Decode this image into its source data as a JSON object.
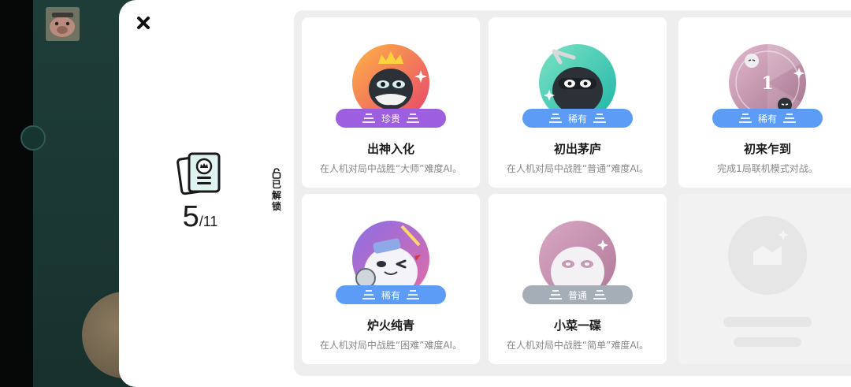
{
  "progress": {
    "unlocked": "5",
    "total": "/11"
  },
  "unlock_label": [
    "已",
    "解",
    "锁"
  ],
  "colors": {
    "precious": "#9d5fe0",
    "rare": "#5c9bf6",
    "common": "#a5adb7"
  },
  "achievements": [
    {
      "title": "出神入化",
      "desc": "在人机对局中战胜“大师”难度AI。",
      "rarity": "珍贵",
      "icon": "king-bomb-icon"
    },
    {
      "title": "初出茅庐",
      "desc": "在人机对局中战胜“普通”难度AI。",
      "rarity": "稀有",
      "icon": "ninja-bomb-icon"
    },
    {
      "title": "初来乍到",
      "desc": "完成1局联机模式对战。",
      "rarity": "稀有",
      "icon": "first-medal-icon"
    },
    {
      "title": "炉火纯青",
      "desc": "在人机对局中战胜“困难”难度AI。",
      "rarity": "稀有",
      "icon": "wink-ghost-icon"
    },
    {
      "title": "小菜一碟",
      "desc": "在人机对局中战胜“简单”难度AI。",
      "rarity": "普通",
      "icon": "plain-ghost-icon"
    }
  ]
}
